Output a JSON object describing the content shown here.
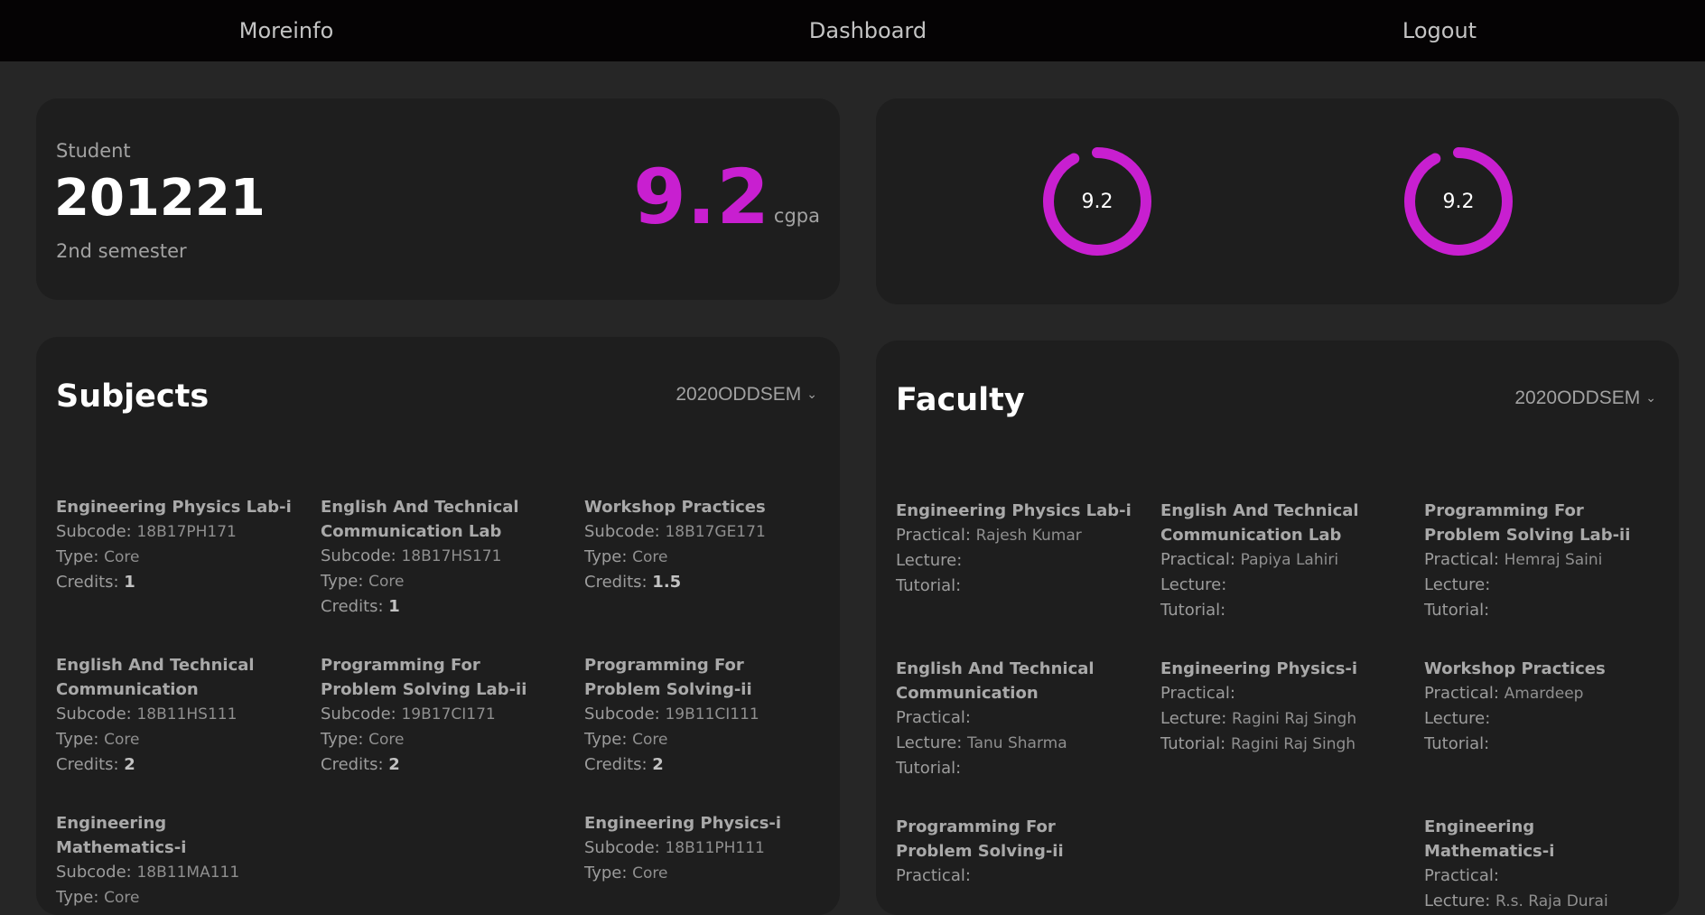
{
  "nav": {
    "moreinfo": "Moreinfo",
    "dashboard": "Dashboard",
    "logout": "Logout"
  },
  "student": {
    "label": "Student",
    "id": "201221",
    "semester": "2nd semester",
    "cgpa": "9.2",
    "cgpa_unit": "cgpa"
  },
  "rings": [
    {
      "value": "9.2",
      "fraction": 0.92,
      "color": "#c81fd0"
    },
    {
      "value": "9.2",
      "fraction": 0.92,
      "color": "#c81fd0"
    }
  ],
  "subjects": {
    "title": "Subjects",
    "semester_select": "2020ODDSEM",
    "labels": {
      "subcode": "Subcode: ",
      "type": "Type: ",
      "credits": "Credits: "
    },
    "items": [
      {
        "name": "Engineering Physics Lab-i",
        "subcode": "18B17PH171",
        "type": "Core",
        "credits": "1"
      },
      {
        "name": "English And Technical Communication Lab",
        "subcode": "18B17HS171",
        "type": "Core",
        "credits": "1"
      },
      {
        "name": "Workshop Practices",
        "subcode": "18B17GE171",
        "type": "Core",
        "credits": "1.5"
      },
      {
        "name": "English And Technical Communication",
        "subcode": "18B11HS111",
        "type": "Core",
        "credits": "2"
      },
      {
        "name": "Programming For Problem Solving Lab-ii",
        "subcode": "19B17CI171",
        "type": "Core",
        "credits": "2"
      },
      {
        "name": "Programming For Problem Solving-ii",
        "subcode": "19B11CI111",
        "type": "Core",
        "credits": "2"
      },
      {
        "name": "Engineering Mathematics-i",
        "subcode": "18B11MA111",
        "type": "Core",
        "credits": ""
      },
      {
        "name": "Engineering Physics-i",
        "subcode": "18B11PH111",
        "type": "Core",
        "credits": ""
      }
    ]
  },
  "faculty": {
    "title": "Faculty",
    "semester_select": "2020ODDSEM",
    "labels": {
      "practical": "Practical: ",
      "lecture": "Lecture: ",
      "tutorial": "Tutorial: "
    },
    "items": [
      {
        "name": "Engineering Physics Lab-i",
        "practical": "Rajesh Kumar",
        "lecture": "",
        "tutorial": ""
      },
      {
        "name": "English And Technical Communication Lab",
        "practical": "Papiya Lahiri",
        "lecture": "",
        "tutorial": ""
      },
      {
        "name": "Programming For Problem Solving Lab-ii",
        "practical": "Hemraj Saini",
        "lecture": "",
        "tutorial": ""
      },
      {
        "name": "English And Technical Communication",
        "practical": "",
        "lecture": "Tanu Sharma",
        "tutorial": ""
      },
      {
        "name": "Engineering Physics-i",
        "practical": "",
        "lecture": "Ragini Raj Singh",
        "tutorial": "Ragini Raj Singh"
      },
      {
        "name": "Workshop Practices",
        "practical": "Amardeep",
        "lecture": "",
        "tutorial": ""
      },
      {
        "name": "Programming For Problem Solving-ii",
        "practical": "",
        "lecture": "",
        "tutorial": ""
      },
      {
        "name": "Engineering Mathematics-i",
        "practical": "",
        "lecture": "R.s. Raja Durai",
        "tutorial": ""
      }
    ]
  }
}
